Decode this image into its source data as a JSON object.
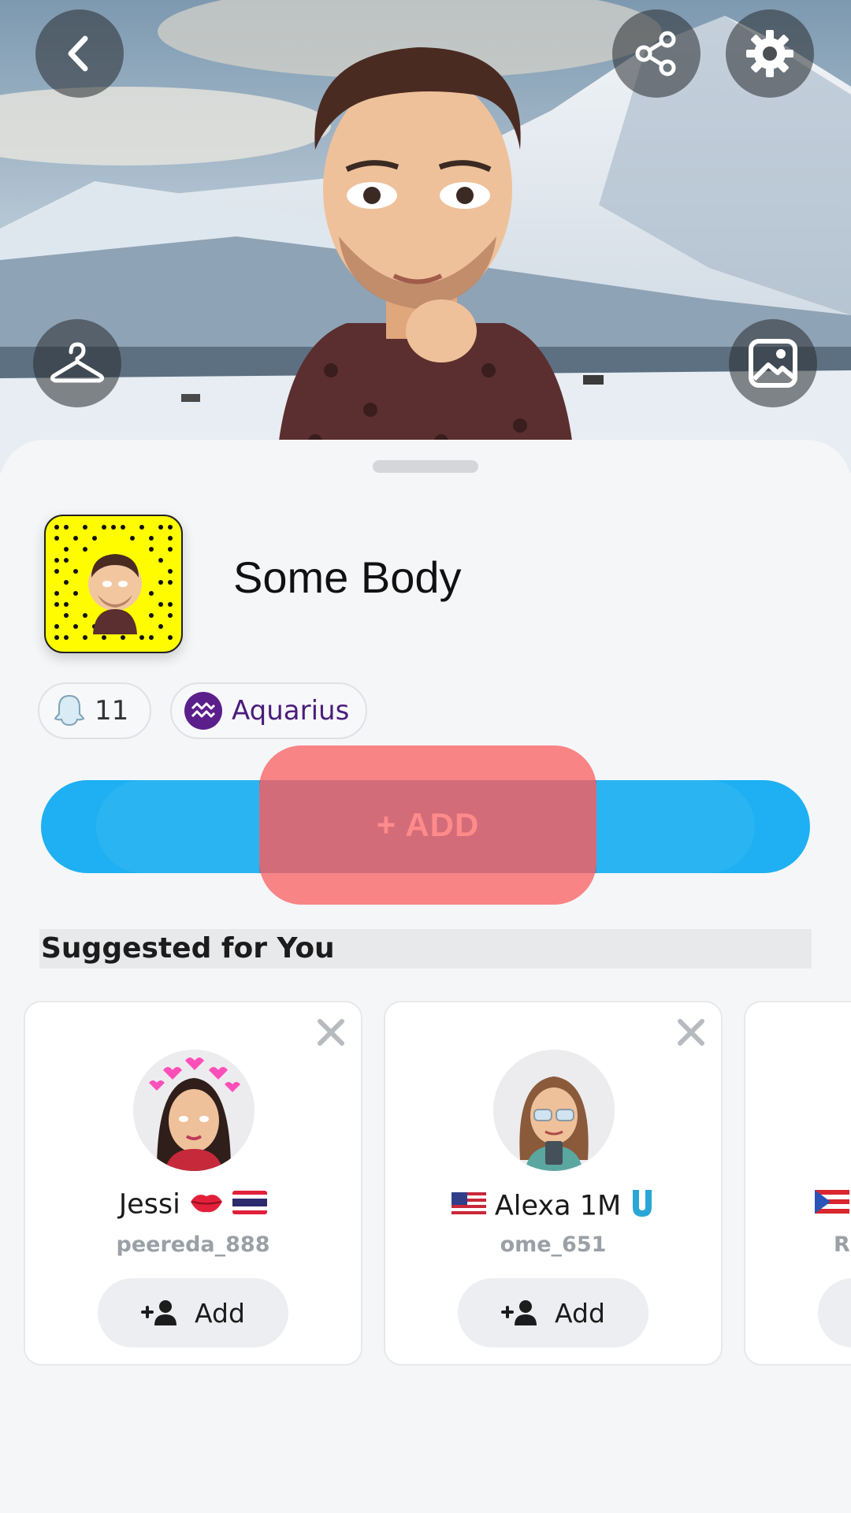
{
  "profile": {
    "display_name": "Some Body",
    "snap_score": "11",
    "zodiac": "Aquarius"
  },
  "header": {
    "icons": [
      "back-icon",
      "share-icon",
      "settings-icon",
      "hanger-icon",
      "gallery-icon"
    ]
  },
  "actions": {
    "add_label": "+ ADD"
  },
  "suggestions": {
    "title": "Suggested for You",
    "add_label": "Add",
    "cards": [
      {
        "name": "Jessi",
        "username": "peereda_888"
      },
      {
        "name": "Alexa 1M",
        "username": "ome_651"
      },
      {
        "name": "",
        "username": "R"
      }
    ]
  },
  "colors": {
    "add_bar": "#1eb0f2",
    "highlight": "#f86464",
    "snapcode": "#fffc00",
    "zodiac": "#5b1f8c"
  }
}
